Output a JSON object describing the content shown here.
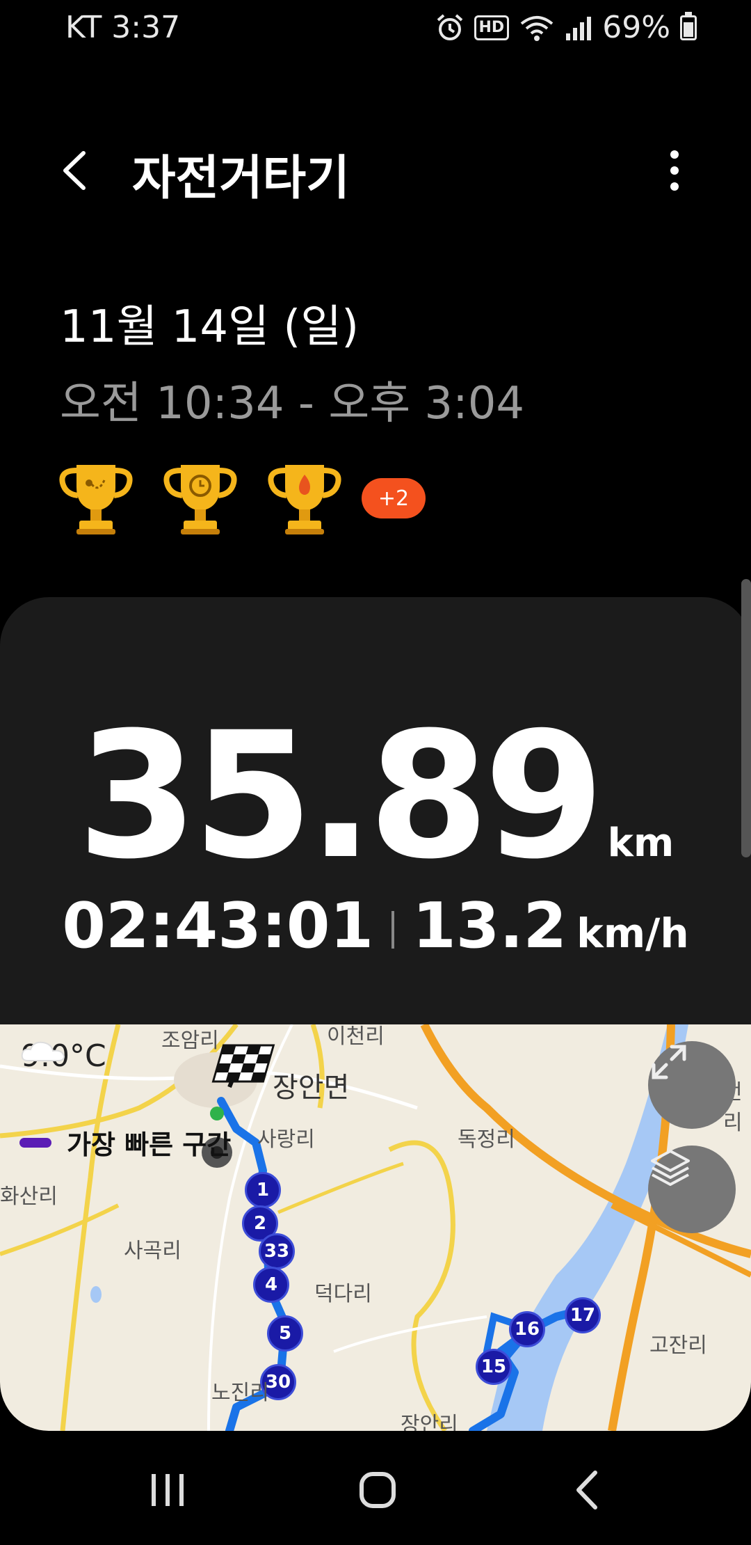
{
  "status_bar": {
    "carrier_time": "KT 3:37",
    "hd": "HD",
    "battery_text": "69%",
    "battery_level": 0.69
  },
  "header": {
    "title": "자전거타기"
  },
  "workout": {
    "date": "11월 14일 (일)",
    "time_range": "오전 10:34 - 오후 3:04",
    "extra_badges": "+2"
  },
  "summary": {
    "distance": "35.89",
    "distance_unit": "km",
    "duration": "02:43:01",
    "speed": "13.2",
    "speed_unit": "km/h"
  },
  "map": {
    "temperature": "9.0°C",
    "legend_label": "가장 빠른 구간",
    "places": [
      "조암리",
      "이천리",
      "장안면",
      "사랑리",
      "독정리",
      "화산리",
      "사곡리",
      "덕다리",
      "고잔리",
      "노진리",
      "장안리",
      "먼리"
    ],
    "markers": [
      "1",
      "2",
      "33",
      "4",
      "5",
      "30",
      "16",
      "17",
      "15"
    ]
  },
  "colors": {
    "accent": "#f4511e",
    "route": "#1a73e8",
    "marker": "#1a1aa6",
    "fastest": "#5b1cb5"
  },
  "icons": [
    "back-arrow-icon",
    "more-vert-icon",
    "trophy-distance-icon",
    "trophy-duration-icon",
    "trophy-calorie-icon",
    "expand-icon",
    "layers-icon",
    "recents-icon",
    "home-icon",
    "back-nav-icon"
  ]
}
